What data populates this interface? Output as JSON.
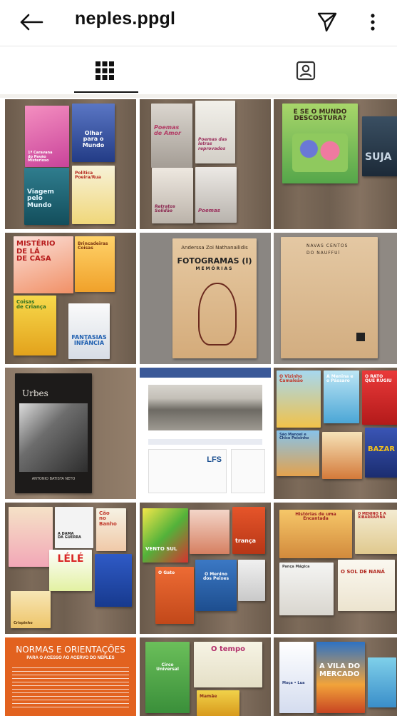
{
  "header": {
    "username": "neples.ppgl"
  },
  "icons": {
    "back": "arrow-left-icon",
    "direct": "paper-plane-icon",
    "more": "more-vertical-icon",
    "grid_tab": "grid-icon",
    "tagged_tab": "tagged-person-icon"
  },
  "tabs": [
    {
      "name": "posts-grid",
      "active": true
    },
    {
      "name": "tagged",
      "active": false
    }
  ],
  "posts": {
    "p1": {
      "b1": "1ª Caravana\ndo Pavão Misterioso",
      "b2": "Olhar\npara o\nMundo",
      "b3": "Viagem\npelo\nMundo",
      "b4": "Política Poeira/Rua"
    },
    "p2": {
      "b1": "Poemas\nde Amor",
      "b2": "Poemas das\nletras reprovados",
      "b3": "Retratos\nSolidão",
      "b4": "Poemas"
    },
    "p3": {
      "b1": "E SE O MUNDO\nDESCOSTURA?",
      "b2": "SUJA"
    },
    "p4": {
      "b1": "MISTÉRIO\nDE LÁ\nDE CASA",
      "b2": "Brincadeiras\nCoisas",
      "b3": "Coisas\nde Criança",
      "b4": "FANTASIAS\nINFÂNCIA"
    },
    "p5": {
      "author": "Anderssa Zoi Nathanailidis",
      "title": "FOTOGRAMAS (I)",
      "subtitle": "MEMÓRIAS"
    },
    "p6": {
      "line1": "NAVAS CENTOS",
      "line2": "DO NAUFFUÍ"
    },
    "p7": {
      "title": "Urbes",
      "author": "ANTONIO BATISTA NETO"
    },
    "p8": {
      "lfs": "LFS"
    },
    "p9": {
      "b1": "O Vizinho\nCamaleão",
      "b2": "A Menina e\no Pássaro",
      "b3": "O RATO\nQUE RUGIU",
      "b4": "São Manoel e\nChico Peixinho",
      "b5": "BAZAR"
    },
    "p10": {
      "b1": "LÉLÉ",
      "b2": "Crispinho",
      "b3": "A DAMA\nDA GUERRA",
      "b4": "Cão\nno\nBanho"
    },
    "p11": {
      "b1": "VENTO SUL",
      "b2": "trança",
      "b3": "O Menino\ndos Peixes",
      "b4": "O Gato"
    },
    "p12": {
      "b1": "Histórias de uma\nEncantada",
      "b2": "O MENINO E A\nXIBARRAPINA",
      "b3": "O SOL DE NANÁ",
      "b4": "Pança Mágica"
    },
    "p13": {
      "title": "NORMAS E ORIENTAÇÕES",
      "subtitle": "PARA O ACESSO AO ACERVO DO NEPLES"
    },
    "p14": {
      "b1": "Circo\nUniversal",
      "b2": "O tempo",
      "b3": "Mamãe"
    },
    "p15": {
      "b1": "Moça • Lua",
      "b2": "A VILA DO\nMERCADO"
    }
  }
}
